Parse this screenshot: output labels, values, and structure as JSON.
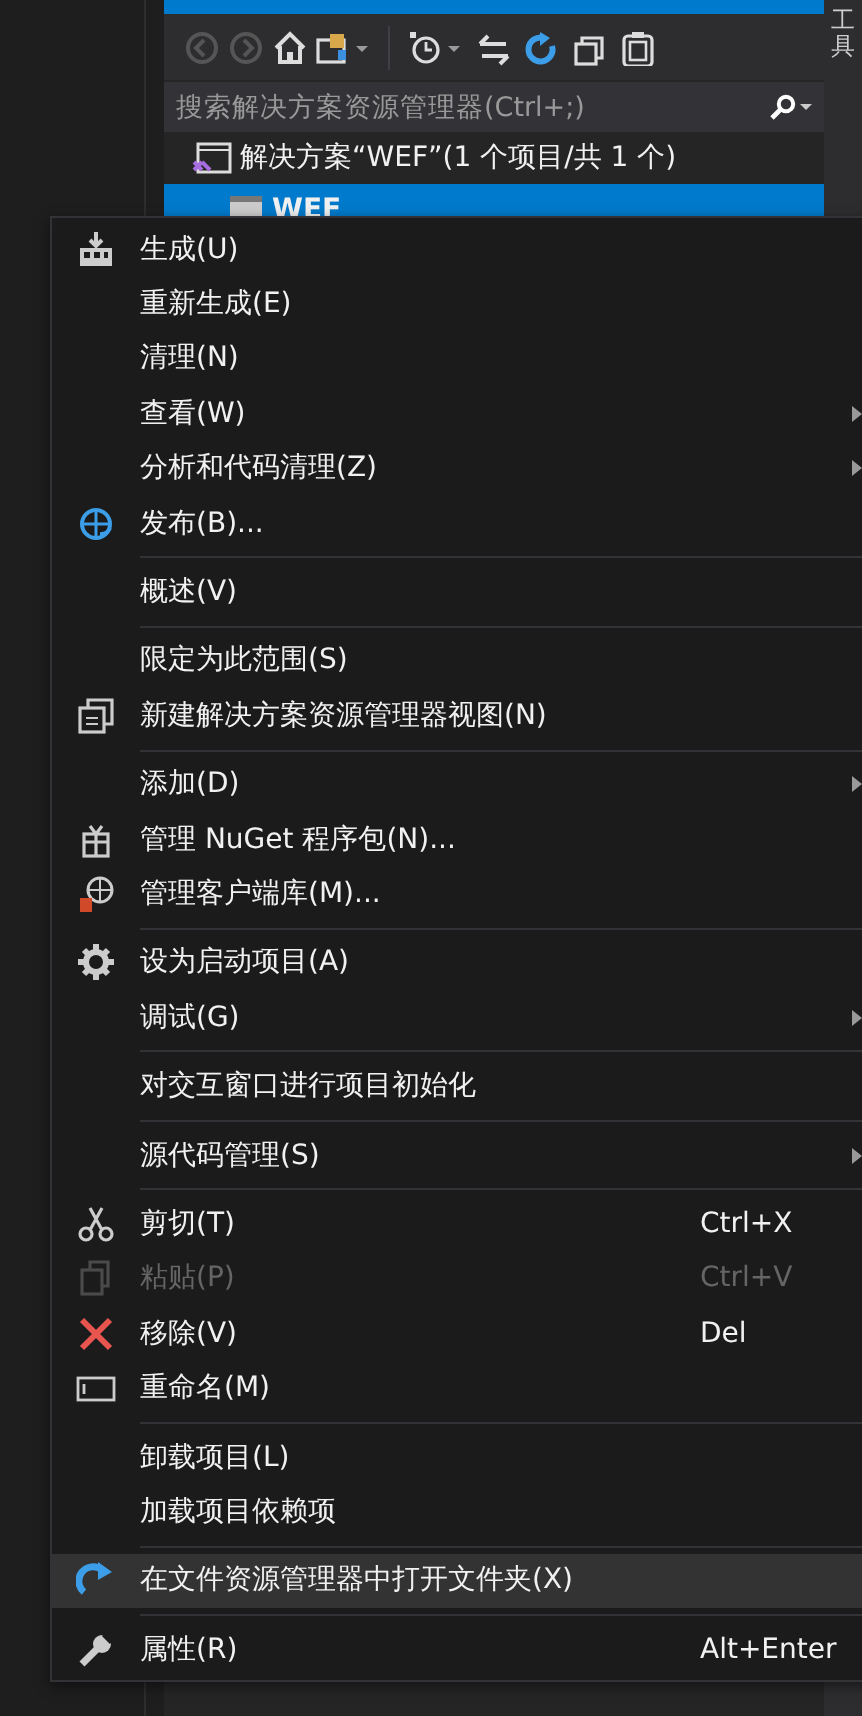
{
  "explorer": {
    "search": {
      "placeholder": "搜索解决方案资源管理器(Ctrl+;)"
    },
    "tree": [
      {
        "label": "解决方案“WEF”(1 个项目/共 1 个)",
        "selected": false,
        "children": [
          {
            "label": "WEF",
            "selected": true
          }
        ]
      }
    ]
  },
  "side_tab": {
    "label": "工具"
  },
  "context_menu": {
    "items": [
      {
        "kind": "item",
        "label": "生成(U)",
        "submenu": false,
        "disabled": false,
        "selected": false
      },
      {
        "kind": "item",
        "label": "重新生成(E)",
        "submenu": false,
        "disabled": false,
        "selected": false
      },
      {
        "kind": "item",
        "label": "清理(N)",
        "submenu": false,
        "disabled": false,
        "selected": false
      },
      {
        "kind": "item",
        "label": "查看(W)",
        "submenu": true,
        "disabled": false,
        "selected": false
      },
      {
        "kind": "item",
        "label": "分析和代码清理(Z)",
        "submenu": true,
        "disabled": false,
        "selected": false
      },
      {
        "kind": "item",
        "label": "发布(B)...",
        "submenu": false,
        "disabled": false,
        "selected": false
      },
      {
        "kind": "separator"
      },
      {
        "kind": "item",
        "label": "概述(V)",
        "submenu": false,
        "disabled": false,
        "selected": false
      },
      {
        "kind": "separator"
      },
      {
        "kind": "item",
        "label": "限定为此范围(S)",
        "submenu": false,
        "disabled": false,
        "selected": false
      },
      {
        "kind": "item",
        "label": "新建解决方案资源管理器视图(N)",
        "submenu": false,
        "disabled": false,
        "selected": false
      },
      {
        "kind": "separator"
      },
      {
        "kind": "item",
        "label": "添加(D)",
        "submenu": true,
        "disabled": false,
        "selected": false
      },
      {
        "kind": "item",
        "label": "管理 NuGet 程序包(N)...",
        "submenu": false,
        "disabled": false,
        "selected": false
      },
      {
        "kind": "item",
        "label": "管理客户端库(M)...",
        "submenu": false,
        "disabled": false,
        "selected": false
      },
      {
        "kind": "separator"
      },
      {
        "kind": "item",
        "label": "设为启动项目(A)",
        "submenu": false,
        "disabled": false,
        "selected": false
      },
      {
        "kind": "item",
        "label": "调试(G)",
        "submenu": true,
        "disabled": false,
        "selected": false
      },
      {
        "kind": "separator"
      },
      {
        "kind": "item",
        "label": "对交互窗口进行项目初始化",
        "submenu": false,
        "disabled": false,
        "selected": false
      },
      {
        "kind": "separator"
      },
      {
        "kind": "item",
        "label": "源代码管理(S)",
        "submenu": true,
        "disabled": false,
        "selected": false
      },
      {
        "kind": "separator"
      },
      {
        "kind": "item",
        "label": "剪切(T)",
        "shortcut": "Ctrl+X",
        "submenu": false,
        "disabled": false,
        "selected": false
      },
      {
        "kind": "item",
        "label": "粘贴(P)",
        "shortcut": "Ctrl+V",
        "submenu": false,
        "disabled": true,
        "selected": false
      },
      {
        "kind": "item",
        "label": "移除(V)",
        "shortcut": "Del",
        "submenu": false,
        "disabled": false,
        "selected": false
      },
      {
        "kind": "item",
        "label": "重命名(M)",
        "submenu": false,
        "disabled": false,
        "selected": false
      },
      {
        "kind": "separator"
      },
      {
        "kind": "item",
        "label": "卸载项目(L)",
        "submenu": false,
        "disabled": false,
        "selected": false
      },
      {
        "kind": "item",
        "label": "加载项目依赖项",
        "submenu": false,
        "disabled": false,
        "selected": false
      },
      {
        "kind": "separator"
      },
      {
        "kind": "item",
        "label": "在文件资源管理器中打开文件夹(X)",
        "submenu": false,
        "disabled": false,
        "selected": true
      },
      {
        "kind": "separator"
      },
      {
        "kind": "item",
        "label": "属性(R)",
        "shortcut": "Alt+Enter",
        "submenu": false,
        "disabled": false,
        "selected": false
      }
    ]
  }
}
